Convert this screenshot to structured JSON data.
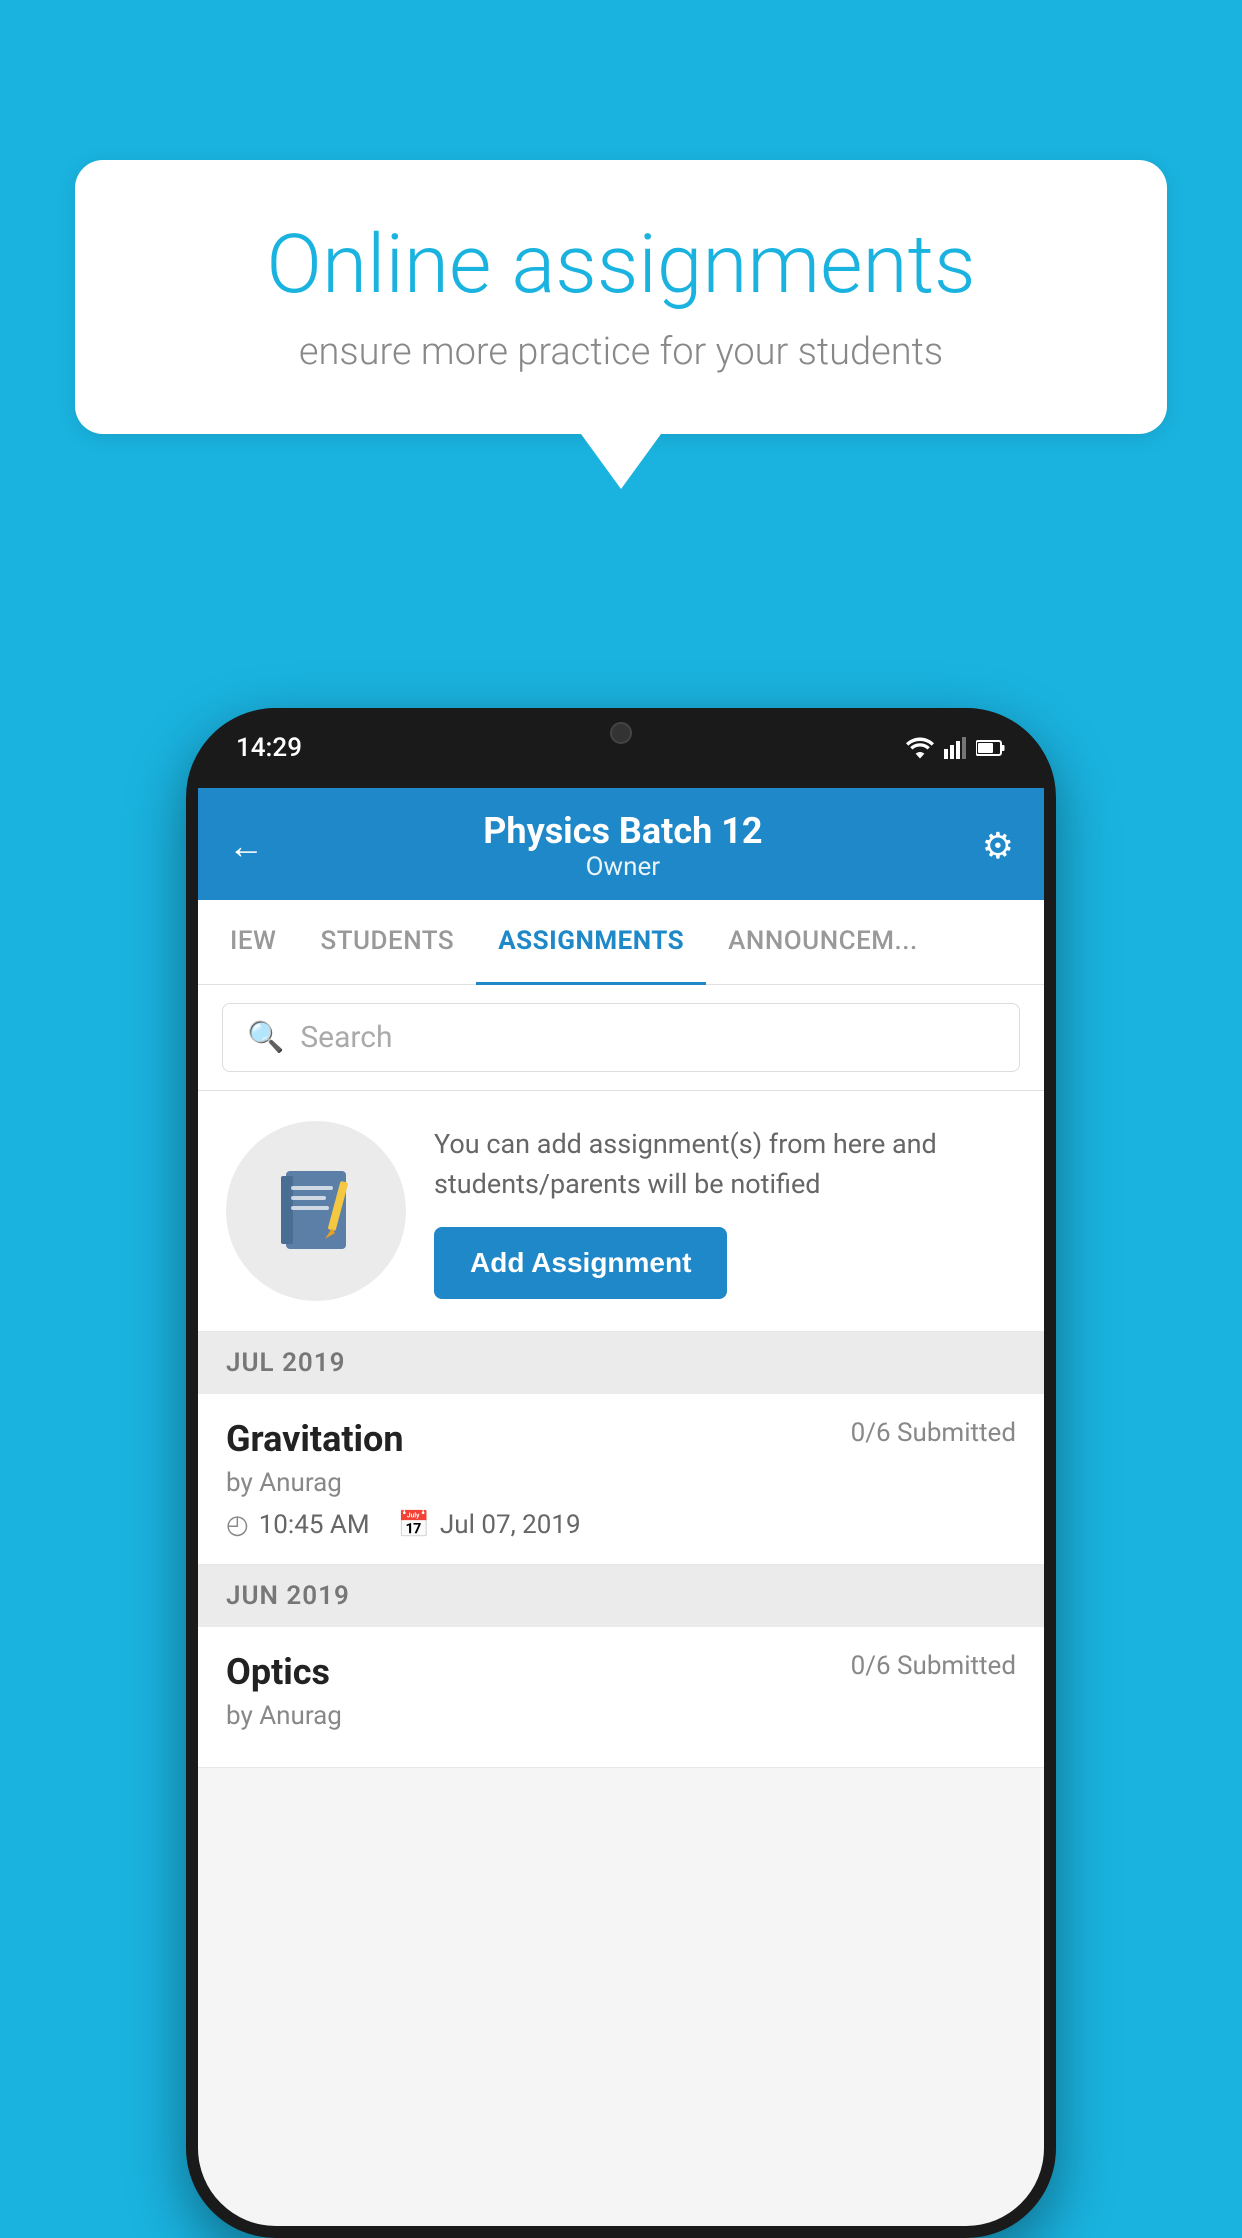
{
  "background": {
    "color": "#1ab3e0"
  },
  "speech_bubble": {
    "title": "Online assignments",
    "subtitle": "ensure more practice for your students"
  },
  "phone": {
    "status_bar": {
      "time": "14:29"
    },
    "header": {
      "title": "Physics Batch 12",
      "subtitle": "Owner"
    },
    "tabs": [
      {
        "label": "IEW",
        "active": false
      },
      {
        "label": "STUDENTS",
        "active": false
      },
      {
        "label": "ASSIGNMENTS",
        "active": true
      },
      {
        "label": "ANNOUNCEM...",
        "active": false
      }
    ],
    "search": {
      "placeholder": "Search"
    },
    "promo": {
      "description": "You can add assignment(s) from here and students/parents will be notified",
      "button_label": "Add Assignment"
    },
    "sections": [
      {
        "month_label": "JUL 2019",
        "assignments": [
          {
            "name": "Gravitation",
            "submitted": "0/6 Submitted",
            "by": "by Anurag",
            "time": "10:45 AM",
            "date": "Jul 07, 2019"
          }
        ]
      },
      {
        "month_label": "JUN 2019",
        "assignments": [
          {
            "name": "Optics",
            "submitted": "0/6 Submitted",
            "by": "by Anurag",
            "time": "",
            "date": ""
          }
        ]
      }
    ]
  }
}
